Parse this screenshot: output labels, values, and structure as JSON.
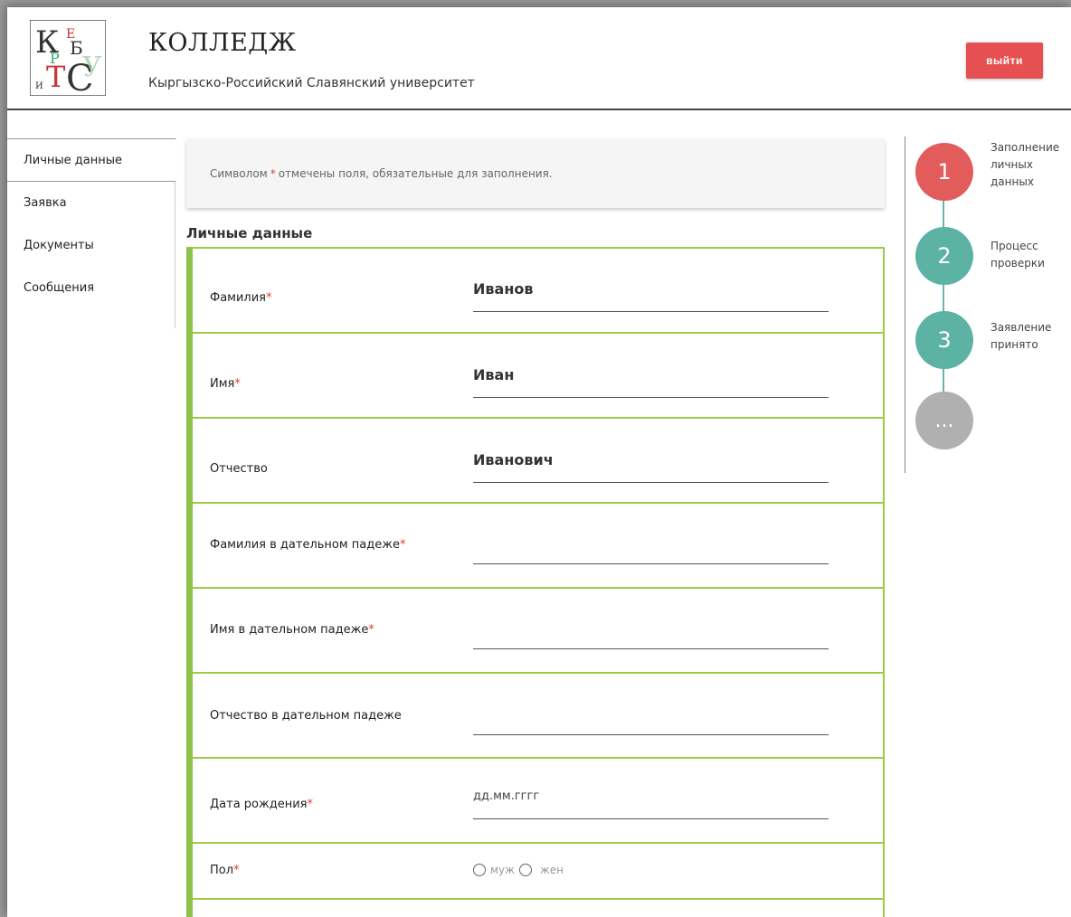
{
  "header": {
    "title": "КОЛЛЕДЖ",
    "subtitle": "Кыргызско-Российский Славянский университет",
    "logout_label": "выйти"
  },
  "sidebar": {
    "items": [
      {
        "label": "Личные данные",
        "active": true
      },
      {
        "label": "Заявка"
      },
      {
        "label": "Документы"
      },
      {
        "label": "Сообщения"
      }
    ]
  },
  "notice": {
    "before": "Символом ",
    "star": "*",
    "after": " отмечены поля, обязательные для заполнения."
  },
  "section_title": "Личные данные",
  "form": {
    "fields": [
      {
        "label": "Фамилия",
        "required": "*",
        "value": "Иванов"
      },
      {
        "label": "Имя",
        "required": "*",
        "value": "Иван"
      },
      {
        "label": "Отчество",
        "required": "",
        "value": "Иванович"
      },
      {
        "label": "Фамилия в дательном падеже",
        "required": "*",
        "value": ""
      },
      {
        "label": "Имя в дательном падеже",
        "required": "*",
        "value": ""
      },
      {
        "label": "Отчество в дательном падеже",
        "required": "",
        "value": ""
      },
      {
        "label": "Дата рождения",
        "required": "*",
        "value": "дд.мм.гггг"
      }
    ],
    "gender": {
      "label": "Пол",
      "required": "*",
      "option_male": "муж",
      "option_female": "жен"
    }
  },
  "stepper": {
    "steps": [
      {
        "number": "1",
        "label": "Заполнение личных данных",
        "color": "#e35c5c"
      },
      {
        "number": "2",
        "label": "Процесс проверки",
        "color": "#5db3a3"
      },
      {
        "number": "3",
        "label": "Заявление принято",
        "color": "#5db3a3"
      },
      {
        "number": "...",
        "label": "",
        "color": "#b0b0b0"
      }
    ]
  },
  "colors": {
    "accent": "#8bc34a",
    "logout": "#e65053"
  }
}
